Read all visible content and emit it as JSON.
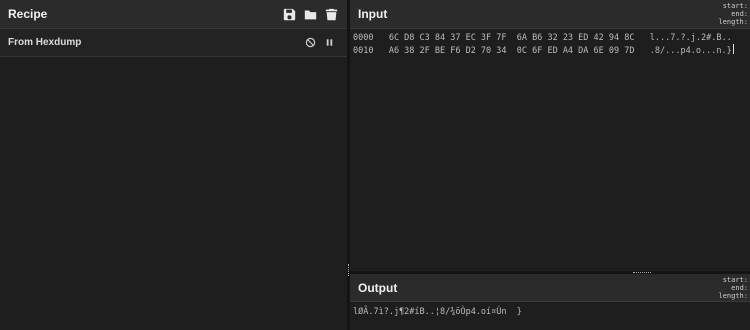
{
  "recipe": {
    "title": "Recipe",
    "icons": [
      "save-icon",
      "folder-icon",
      "trash-icon"
    ],
    "operations": [
      {
        "name": "From Hexdump",
        "icons": [
          "disable-icon",
          "pause-icon"
        ]
      }
    ]
  },
  "input": {
    "title": "Input",
    "stats": [
      "start:",
      "end:",
      "length:"
    ],
    "lines": [
      "0000   6C D8 C3 84 37 EC 3F 7F  6A B6 32 23 ED 42 94 8C   l...7.?.j.2#.B..",
      "0010   A6 38 2F BE F6 D2 70 34  0C 6F ED A4 DA 6E 09 7D   .8/...p4.o...n.}"
    ]
  },
  "output": {
    "title": "Output",
    "stats": [
      "start:",
      "end:",
      "length:"
    ],
    "text": "lØÃ.7ì?.j¶2#íB..¦8/¾öÒp4.oí¤Ún  }"
  }
}
